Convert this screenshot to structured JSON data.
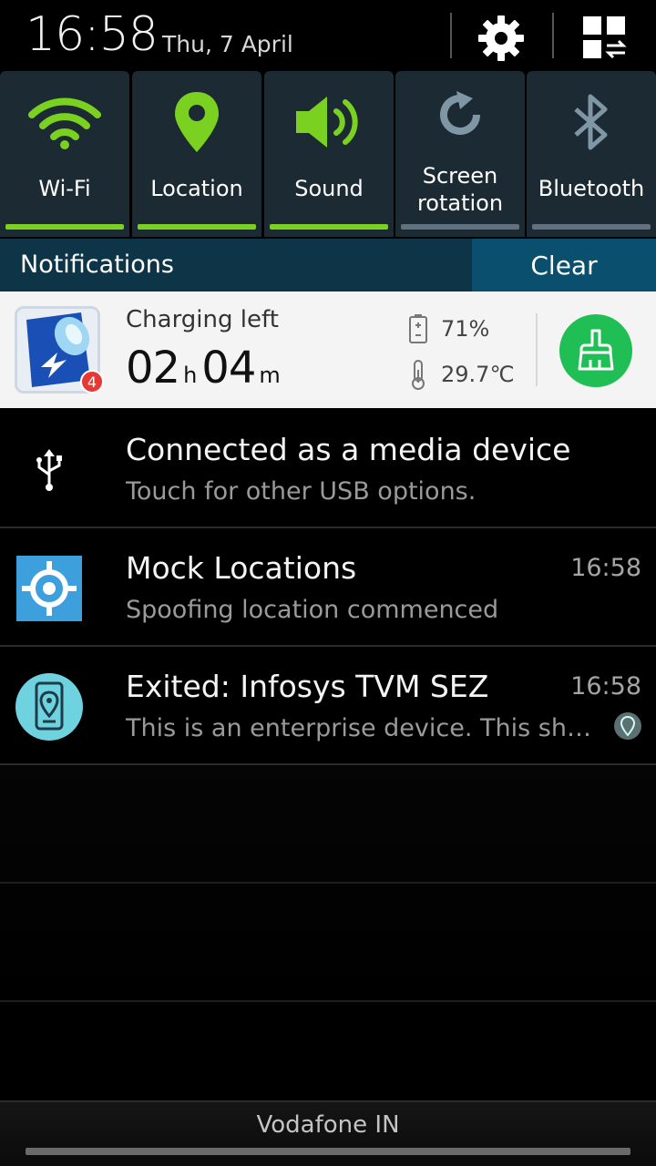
{
  "header": {
    "time": "16:58",
    "date": "Thu, 7 April"
  },
  "quick_settings": [
    {
      "label": "Wi-Fi",
      "icon": "wifi-icon",
      "active": true
    },
    {
      "label": "Location",
      "icon": "location-pin-icon",
      "active": true
    },
    {
      "label": "Sound",
      "icon": "speaker-icon",
      "active": true
    },
    {
      "label": "Screen rotation",
      "line1": "Screen",
      "line2": "rotation",
      "icon": "screen-rotation-icon",
      "active": false
    },
    {
      "label": "Bluetooth",
      "icon": "bluetooth-icon",
      "active": false
    }
  ],
  "notifications": {
    "title": "Notifications",
    "clear_label": "Clear"
  },
  "charging": {
    "label": "Charging left",
    "hours": "02",
    "hours_unit": "h",
    "minutes": "04",
    "minutes_unit": "m",
    "battery": "71%",
    "temperature": "29.7℃",
    "badge_count": "4"
  },
  "rows": [
    {
      "title": "Connected as a media device",
      "subtitle": "Touch for other USB options.",
      "time": "",
      "icon": "usb-icon"
    },
    {
      "title": "Mock Locations",
      "subtitle": "Spoofing location commenced",
      "time": "16:58",
      "icon": "crosshair-icon"
    },
    {
      "title": "Exited: Infosys TVM SEZ",
      "subtitle": "This is an enterprise device. This shou..",
      "time": "16:58",
      "icon": "phone-location-icon"
    }
  ],
  "carrier": "Vodafone IN",
  "colors": {
    "active_green": "#7bd11f",
    "tile_bg": "#1c2a33",
    "notif_bar": "#0e3547",
    "clear_bg": "#0a4f6e",
    "clean_green": "#1fbf55"
  }
}
